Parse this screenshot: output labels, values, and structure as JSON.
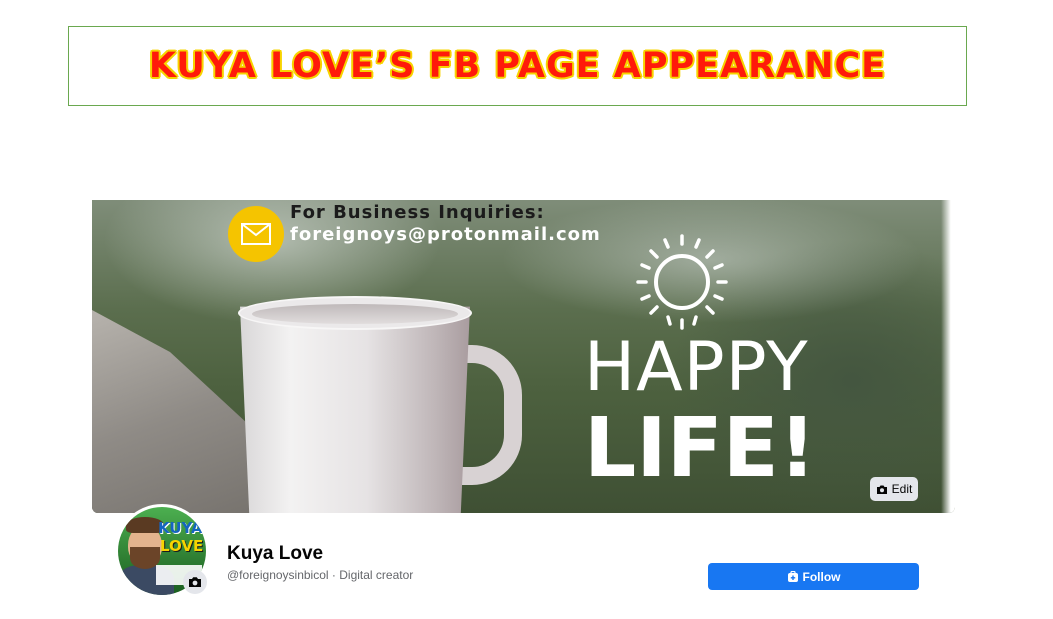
{
  "banner": {
    "title": "KUYA LOVE’S FB PAGE APPEARANCE"
  },
  "cover": {
    "business_label": "For Business Inquiries:",
    "business_email": "foreignoys@protonmail.com",
    "headline_1": "HAPPY",
    "headline_2": "LIFE!",
    "edit_label": "Edit",
    "edit_icon": "camera-icon",
    "mail_icon": "mail-icon",
    "mail_icon_color": "#f5c400"
  },
  "profile": {
    "name": "Kuya Love",
    "subtitle": "@foreignoysinbicol · Digital creator",
    "avatar_text_1": "KUYA",
    "avatar_text_2": "LOVE",
    "camera_icon": "camera-icon"
  },
  "actions": {
    "follow_label": "Follow",
    "follow_icon": "follow-icon",
    "follow_color": "#1877f2"
  }
}
